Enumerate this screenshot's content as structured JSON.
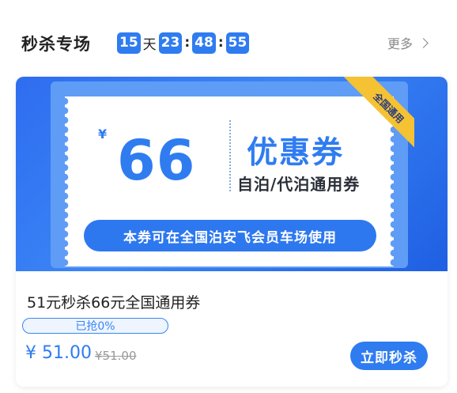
{
  "header": {
    "title": "秒杀专场",
    "countdown": {
      "days": "15",
      "day_unit": "天",
      "hours": "23",
      "minutes": "48",
      "seconds": "55",
      "separator": ":"
    },
    "more_label": "更多"
  },
  "card": {
    "banner": {
      "currency": "¥",
      "amount": "66",
      "coupon_title": "优惠券",
      "coupon_subtitle": "自泊/代泊通用券",
      "usage_note": "本券可在全国泊安飞会员车场使用",
      "ribbon_label": "全国通用"
    },
    "name": "51元秒杀66元全国通用券",
    "progress": {
      "label": "已抢0%",
      "fraction": 0
    },
    "price": "¥ 51.00",
    "original_price": "¥51.00",
    "buy_label": "立即秒杀"
  },
  "colors": {
    "accent": "#2f7cf0",
    "ribbon": "#f4c233"
  },
  "icons": {
    "more": "chevron-right-icon"
  }
}
